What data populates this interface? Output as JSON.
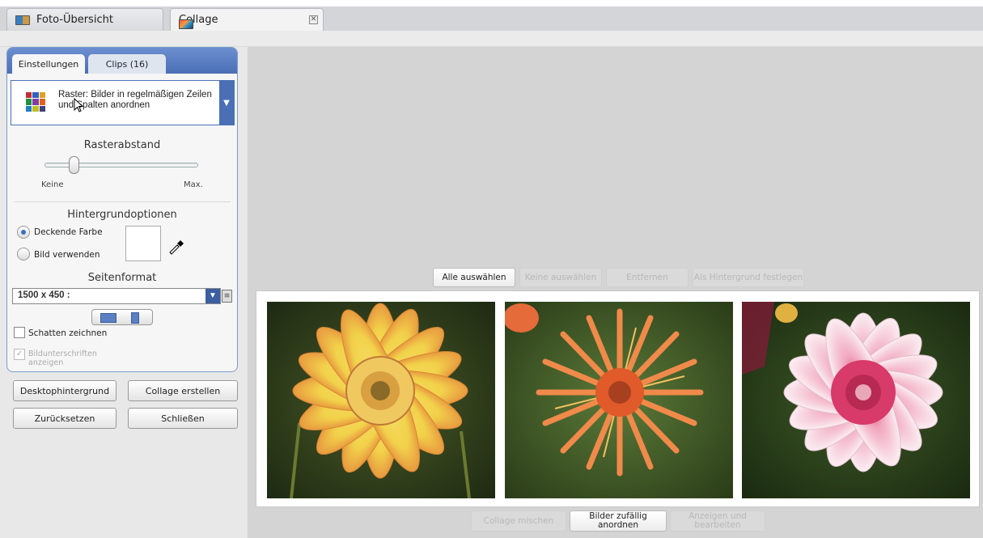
{
  "tabs": [
    {
      "label": "Foto-Übersicht",
      "icon": "photo-overview-icon"
    },
    {
      "label": "Collage",
      "icon": "collage-icon",
      "close": "✕"
    }
  ],
  "panel": {
    "tabs": [
      "Einstellungen",
      "Clips (16)"
    ],
    "layout": {
      "label": "Raster: Bilder in regelmäßigen Zeilen und Spalten anordnen"
    },
    "spacing": {
      "title": "Rasterabstand",
      "min_label": "Keine",
      "max_label": "Max.",
      "value_fraction": 0.16
    },
    "background": {
      "title": "Hintergrundoptionen",
      "option_color": "Deckende Farbe",
      "option_image": "Bild verwenden",
      "selected": "Deckende Farbe",
      "color": "#ffffff"
    },
    "format": {
      "title": "Seitenformat",
      "value": "1500 x 450 :"
    },
    "shadow_label": "Schatten zeichnen",
    "captions_label": "Bildunterschriften anzeigen",
    "buttons": {
      "desktop": "Desktophintergrund",
      "create": "Collage erstellen",
      "reset": "Zurücksetzen",
      "close": "Schließen"
    }
  },
  "toolbar": {
    "select_all": "Alle auswählen",
    "select_none": "Keine auswählen",
    "remove": "Entfernen",
    "set_background": "Als Hintergrund festlegen"
  },
  "bottom": {
    "shuffle": "Collage mischen",
    "random": "Bilder zufällig anordnen",
    "view_edit": "Anzeigen und bearbeiten"
  },
  "colors": {
    "accent": "#4a6fb5",
    "panel_border": "#7a9ccc",
    "stage": "#d4d4d4"
  }
}
